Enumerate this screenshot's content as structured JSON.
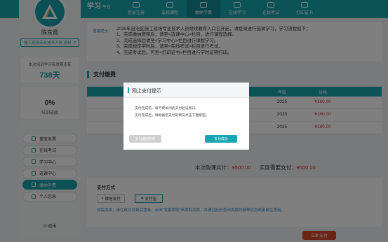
{
  "header": {
    "brand": "学习",
    "brand_sub": "平台",
    "nav": [
      {
        "label": "登录注册",
        "active": false
      },
      {
        "label": "选择课程",
        "active": false
      },
      {
        "label": "缴纳学费",
        "active": true
      },
      {
        "label": "在线学习",
        "active": false
      },
      {
        "label": "在线考试",
        "active": false
      },
      {
        "label": "打印证书",
        "active": false
      }
    ]
  },
  "sidebar": {
    "user_name": "陈东霞",
    "user_role": "施工现场专业技术人员-资料",
    "days_label": "本次培训学习有效期还有",
    "days_value": "738天",
    "progress_value": "0%",
    "progress_label": "培训进度",
    "menu": [
      {
        "label": "重取发票",
        "icon": "invoice-icon",
        "active": false
      },
      {
        "label": "在线考试",
        "icon": "exam-icon",
        "active": false
      },
      {
        "label": "学习中心",
        "icon": "study-icon",
        "active": false
      },
      {
        "label": "选课中心",
        "icon": "course-icon",
        "active": false
      },
      {
        "label": "缴纳学费",
        "icon": "payment-icon",
        "active": true
      },
      {
        "label": "个人信息",
        "icon": "user-icon",
        "active": false
      }
    ],
    "logout": "退出"
  },
  "notice": {
    "tag": "温馨提示：",
    "lines": [
      "2025年自治区施工现场专业技术人员继续教育入口已开启，请登录进行选课学习，学习流程如下：",
      "1、完成缴纳费用后，请至<选课中心>栏目，进行课程选择。",
      "2、完成选择后请至<学习中心>栏目进行课程学习。",
      "3、完成规定学时后，请至<在线考试>栏目进行考试。",
      "4、完成考试后，可至<打印证书>栏目进行学时证明打印。"
    ]
  },
  "payment": {
    "section_title": "支付缴费",
    "table_headers": {
      "year": "年股",
      "price": "价格"
    },
    "rows": [
      {
        "year": "2025",
        "price": "¥160.00"
      },
      {
        "year": "2025",
        "price": "¥160.00"
      },
      {
        "year": "2025",
        "price": "¥180.00"
      }
    ],
    "total_label": "本次购课共计：",
    "total_value": "¥500.00",
    "actual_label": "实际需要支付：",
    "actual_value": "¥500.00",
    "method_title": "支付方式",
    "methods": [
      {
        "label": "微信支付",
        "selected": false
      },
      {
        "label": "支付宝",
        "selected": true
      }
    ],
    "note": "如需发票，请在成功交费后登录，点击\"发票索取\"来索取发票，并通过此处查询发票的邮寄状态或者前往查询。",
    "pay_button": "立即支付"
  },
  "modal": {
    "title": "网上支付提示",
    "line1": "支付完成前，请不要关闭此支付验证窗口。",
    "line2": "支付完成后，请根据您支付的情况点击下面按钮。",
    "btn_problem": "支付遇到问题",
    "btn_done": "支付成功"
  }
}
